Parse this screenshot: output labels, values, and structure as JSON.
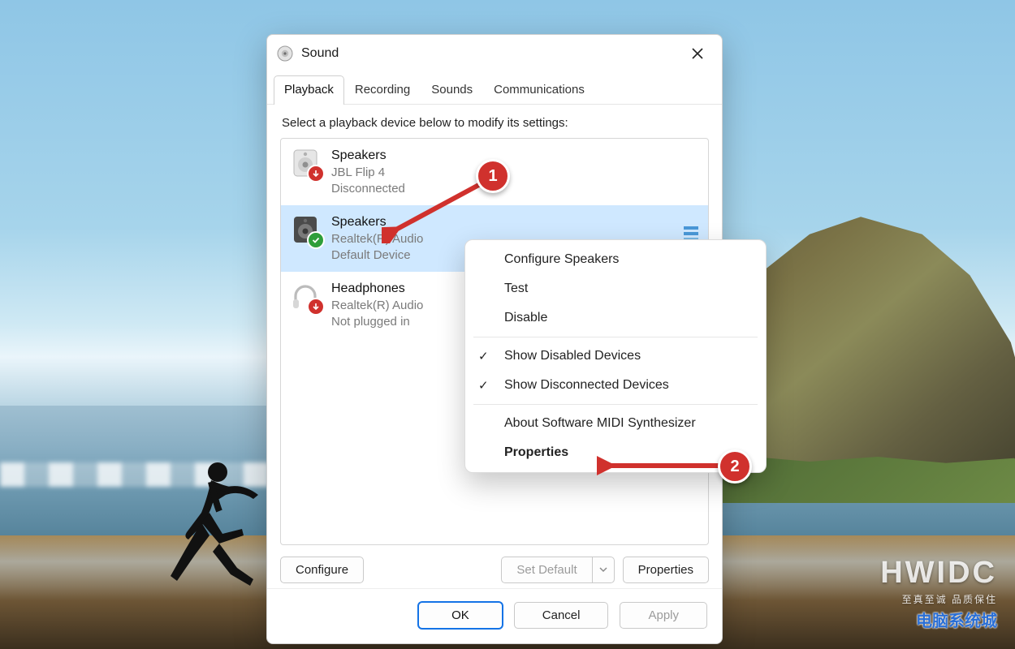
{
  "window": {
    "title": "Sound",
    "close_tooltip": "Close"
  },
  "tabs": {
    "playback": "Playback",
    "recording": "Recording",
    "sounds": "Sounds",
    "communications": "Communications"
  },
  "instruction": "Select a playback device below to modify its settings:",
  "devices": [
    {
      "title": "Speakers",
      "subtitle": "JBL Flip 4",
      "status": "Disconnected",
      "badge": "down"
    },
    {
      "title": "Speakers",
      "subtitle": "Realtek(R) Audio",
      "status": "Default Device",
      "badge": "check"
    },
    {
      "title": "Headphones",
      "subtitle": "Realtek(R) Audio",
      "status": "Not plugged in",
      "badge": "down"
    }
  ],
  "context_menu": {
    "configure": "Configure Speakers",
    "test": "Test",
    "disable": "Disable",
    "show_disabled": "Show Disabled Devices",
    "show_disconnected": "Show Disconnected Devices",
    "about": "About Software MIDI Synthesizer",
    "properties": "Properties"
  },
  "buttons": {
    "configure": "Configure",
    "set_default": "Set Default",
    "properties": "Properties",
    "ok": "OK",
    "cancel": "Cancel",
    "apply": "Apply"
  },
  "callouts": {
    "one": "1",
    "two": "2"
  },
  "watermark": {
    "main": "HWIDC",
    "sub": "至真至诚 品质保住",
    "logo": "电脑系统城"
  }
}
